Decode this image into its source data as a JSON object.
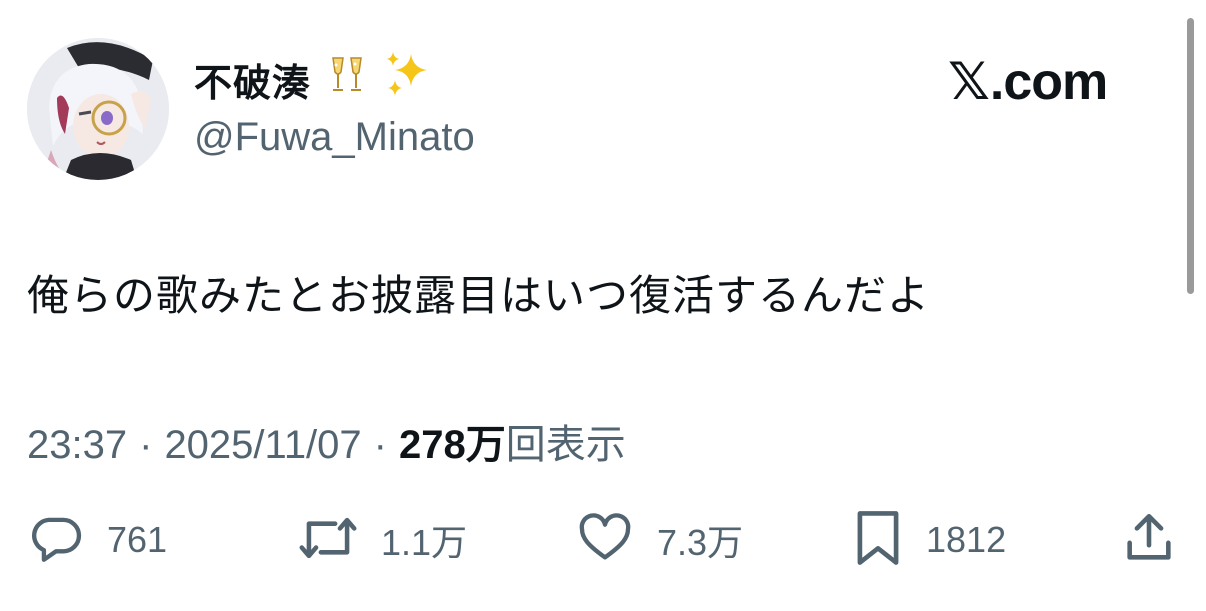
{
  "author": {
    "display_name": "不破湊",
    "handle": "@Fuwa_Minato",
    "name_emojis": [
      "champagne-glasses-emoji",
      "sparkles-emoji"
    ]
  },
  "brand": {
    "label": ".com",
    "glyph": "𝕏"
  },
  "tweet": {
    "text": "俺らの歌みたとお披露目はいつ復活するんだよ"
  },
  "meta": {
    "time": "23:37",
    "separator": "·",
    "date": "2025/11/07",
    "views_count": "278万",
    "views_label": "回表示"
  },
  "actions": {
    "reply": {
      "icon": "reply-icon",
      "count": "761"
    },
    "repost": {
      "icon": "repost-icon",
      "count": "1.1万"
    },
    "like": {
      "icon": "heart-icon",
      "count": "7.3万"
    },
    "bookmark": {
      "icon": "bookmark-icon",
      "count": "1812"
    },
    "share": {
      "icon": "share-icon"
    }
  },
  "colors": {
    "text_primary": "#0f1419",
    "text_secondary": "#536471",
    "background": "#ffffff",
    "sparkle": "#f5c518"
  }
}
